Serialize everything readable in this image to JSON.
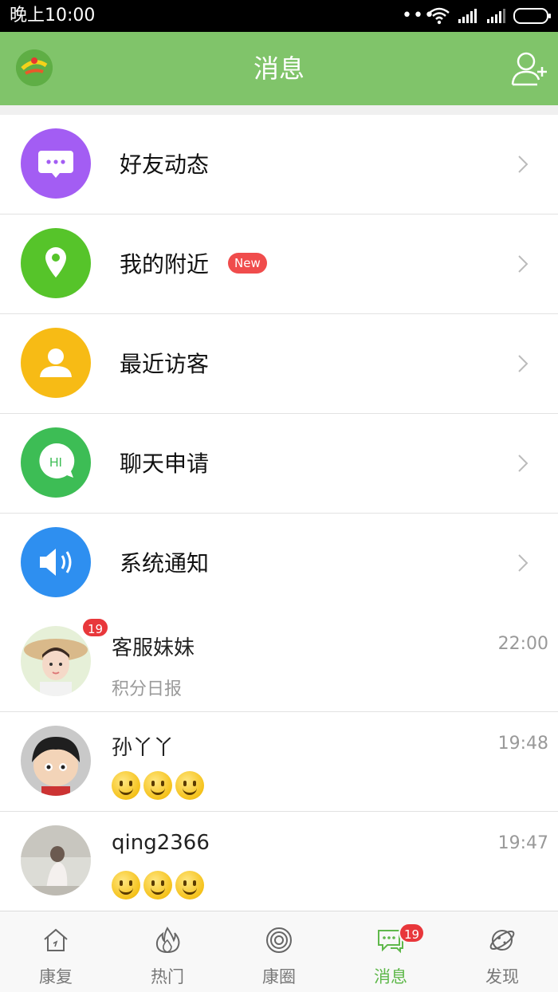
{
  "status_bar": {
    "time": "晚上10:00",
    "dots": "•••"
  },
  "header": {
    "title": "消息",
    "logo_icon": "app-logo-icon",
    "add_friend_icon": "add-user-icon"
  },
  "menu": {
    "items": [
      {
        "label": "好友动态",
        "icon": "chat-bubble-icon",
        "color": "#a35df3"
      },
      {
        "label": "我的附近",
        "icon": "location-pin-icon",
        "color": "#56c42a",
        "badge": "New"
      },
      {
        "label": "最近访客",
        "icon": "user-icon",
        "color": "#f7bb15"
      },
      {
        "label": "聊天申请",
        "icon": "hi-bubble-icon",
        "color": "#3dbd55",
        "icon_text": "HI"
      },
      {
        "label": "系统通知",
        "icon": "speaker-icon",
        "color": "#2e8ff0"
      }
    ]
  },
  "chats": [
    {
      "name": "客服妹妹",
      "time": "22:00",
      "preview": "积分日报",
      "unread": "19"
    },
    {
      "name": "孙丫丫",
      "time": "19:48",
      "preview_emoji": "smile-emoji x3"
    },
    {
      "name": "qing2366",
      "time": "19:47",
      "preview_emoji": "smile-emoji x3"
    }
  ],
  "bottom_nav": {
    "items": [
      {
        "label": "康复",
        "icon": "home-icon"
      },
      {
        "label": "热门",
        "icon": "flame-icon"
      },
      {
        "label": "康圈",
        "icon": "circles-icon"
      },
      {
        "label": "消息",
        "icon": "message-icon",
        "active": true,
        "badge": "19"
      },
      {
        "label": "发现",
        "icon": "planet-icon"
      }
    ]
  },
  "colors": {
    "header": "#80c46a",
    "accent": "#5fb84b",
    "badge": "#e8373b"
  }
}
